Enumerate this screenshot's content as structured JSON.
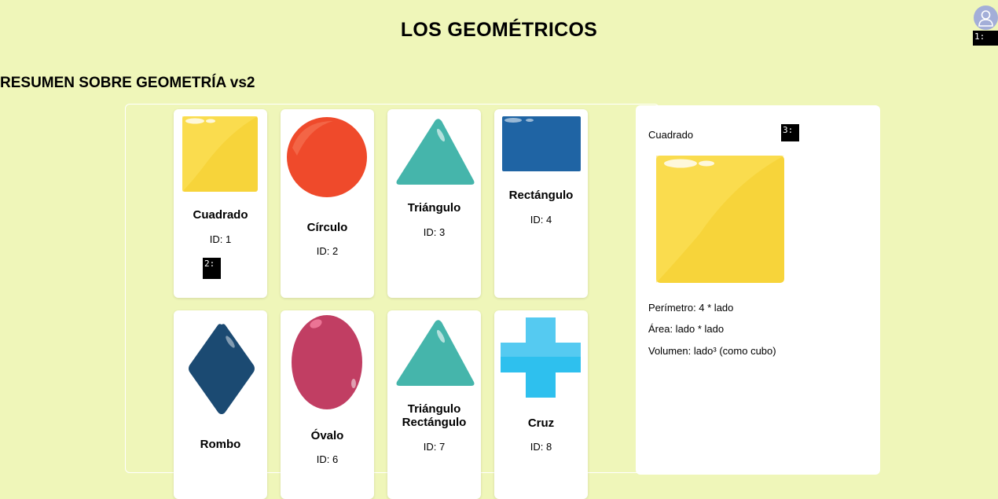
{
  "header": {
    "title": "LOS GEOMÉTRICOS",
    "subtitle": "RESUMEN SOBRE GEOMETRÍA vs2"
  },
  "user": {
    "avatar_icon": "user-avatar-icon"
  },
  "markers": {
    "m1": "1:",
    "m2": "2:",
    "m3": "3:"
  },
  "shapes": [
    {
      "name": "Cuadrado",
      "id_label": "ID: 1",
      "color": "#f7d43a"
    },
    {
      "name": "Círculo",
      "id_label": "ID: 2",
      "color": "#ef4a2b"
    },
    {
      "name": "Triángulo",
      "id_label": "ID: 3",
      "color": "#45b5ab"
    },
    {
      "name": "Rectángulo",
      "id_label": "ID: 4",
      "color": "#1f64a4"
    },
    {
      "name": "Rombo",
      "id_label": "",
      "color": "#1b4a72"
    },
    {
      "name": "Óvalo",
      "id_label": "ID: 6",
      "color": "#c13e63"
    },
    {
      "name": "Triángulo Rectángulo",
      "name_line1": "Triángulo",
      "name_line2": "Rectángulo",
      "id_label": "ID: 7",
      "color": "#45b5ab"
    },
    {
      "name": "Cruz",
      "id_label": "ID: 8",
      "color": "#2ec0ee"
    }
  ],
  "detail": {
    "name": "Cuadrado",
    "perimeter": "Perímetro: 4 * lado",
    "area": "Área: lado * lado",
    "volume": "Volumen: lado³ (como cubo)",
    "color": "#f7d43a"
  }
}
